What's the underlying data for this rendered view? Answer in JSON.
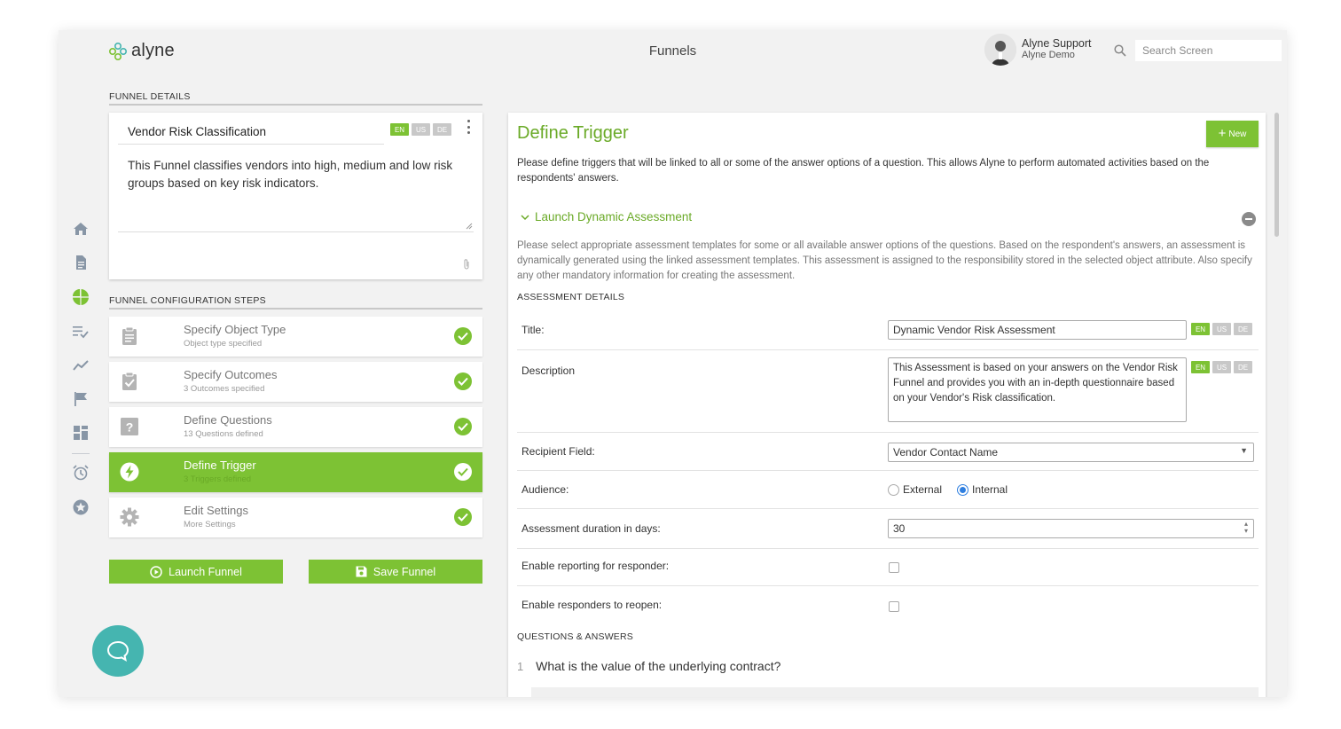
{
  "header": {
    "logo_text": "alyne",
    "page_title": "Funnels",
    "user_name": "Alyne Support",
    "user_org": "Alyne Demo",
    "search_placeholder": "Search Screen"
  },
  "sidebar": {
    "icons": [
      "home-icon",
      "document-icon",
      "pie-chart-icon",
      "checklist-icon",
      "trend-icon",
      "flag-icon",
      "dashboard-icon",
      "alarm-icon",
      "star-icon"
    ],
    "active": "pie-chart-icon"
  },
  "funnel_details": {
    "section_label": "FUNNEL DETAILS",
    "name": "Vendor Risk Classification",
    "languages": [
      "EN",
      "US",
      "DE"
    ],
    "description": "This Funnel classifies vendors into high, medium and low risk groups based on key risk indicators."
  },
  "config_steps": {
    "section_label": "FUNNEL CONFIGURATION STEPS",
    "steps": [
      {
        "title": "Specify Object Type",
        "sub": "Object type specified",
        "icon": "clipboard-icon",
        "done": true
      },
      {
        "title": "Specify Outcomes",
        "sub": "3 Outcomes specified",
        "icon": "clipboard-check-icon",
        "done": true
      },
      {
        "title": "Define Questions",
        "sub": "13 Questions defined",
        "icon": "question-icon",
        "done": true
      },
      {
        "title": "Define Trigger",
        "sub": "3 Triggers defined",
        "icon": "lightning-icon",
        "done": true,
        "active": true
      },
      {
        "title": "Edit Settings",
        "sub": "More Settings",
        "icon": "gear-icon",
        "done": true
      }
    ]
  },
  "actions": {
    "launch": "Launch Funnel",
    "save": "Save Funnel"
  },
  "trigger": {
    "title": "Define Trigger",
    "new_button": "New",
    "intro": "Please define triggers that will be linked to all or some of the answer options of a question. This allows Alyne to perform automated activities based on the respondents' answers.",
    "accordion_title": "Launch Dynamic Assessment",
    "note": "Please select appropriate assessment templates for some or all available answer options of the questions. Based on the respondent's answers, an assessment is dynamically generated using the linked assessment templates. This assessment is assigned to the responsibility stored in the selected object attribute. Also specify any other mandatory information for creating the assessment.",
    "assessment_details_label": "ASSESSMENT DETAILS",
    "title_label": "Title:",
    "title_value": "Dynamic Vendor Risk Assessment",
    "description_label": "Description",
    "description_value": "This Assessment is based on your answers on the Vendor Risk Funnel and provides you with an in-depth questionnaire based on your Vendor's Risk classification.",
    "recipient_label": "Recipient Field:",
    "recipient_value": "Vendor Contact Name",
    "audience_label": "Audience:",
    "audience_options": [
      "External",
      "Internal"
    ],
    "audience_selected": "Internal",
    "duration_label": "Assessment duration in days:",
    "duration_value": "30",
    "reporting_label": "Enable reporting for responder:",
    "reporting_checked": false,
    "reopen_label": "Enable responders to reopen:",
    "reopen_checked": false,
    "qa_label": "QUESTIONS & ANSWERS",
    "question_number": "1",
    "question_text": "What is the value of the underlying contract?"
  },
  "colors": {
    "accent": "#7dc234",
    "accent_text": "#6aaa27",
    "chat": "#45b5b0",
    "radio_selected": "#2f7fe0"
  }
}
